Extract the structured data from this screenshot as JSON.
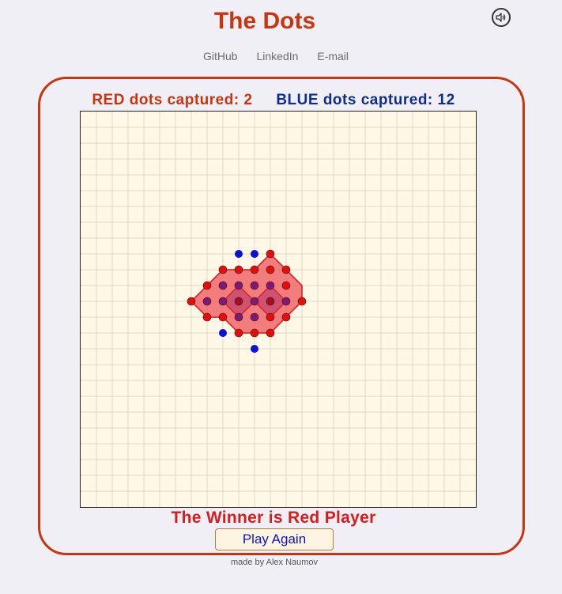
{
  "header": {
    "title": "The Dots",
    "sound_icon": "speaker-icon"
  },
  "links": [
    {
      "label": "GitHub"
    },
    {
      "label": "LinkedIn"
    },
    {
      "label": "E-mail"
    }
  ],
  "scores": {
    "red_label": "RED dots captured:",
    "red_count": "2",
    "blue_label": "BLUE dots captured:",
    "blue_count": "12"
  },
  "board": {
    "cols": 25,
    "rows": 25,
    "background": "#fff8e6",
    "grid_color": "#e3d6c1",
    "red_color": "#e01010",
    "blue_color": "#0a12d8",
    "captured_color": "#7c1a78",
    "territory_color": "#f07070",
    "red_dots": [
      [
        12,
        9
      ],
      [
        11,
        10
      ],
      [
        12,
        10
      ],
      [
        13,
        10
      ],
      [
        9,
        10
      ],
      [
        10,
        10
      ],
      [
        8,
        11
      ],
      [
        9,
        11
      ],
      [
        10,
        11
      ],
      [
        11,
        11
      ],
      [
        12,
        11
      ],
      [
        13,
        11
      ],
      [
        7,
        12
      ],
      [
        14,
        12
      ],
      [
        8,
        13
      ],
      [
        13,
        13
      ],
      [
        10,
        14
      ],
      [
        11,
        14
      ],
      [
        12,
        14
      ],
      [
        9,
        13
      ],
      [
        10,
        13
      ],
      [
        11,
        13
      ],
      [
        12,
        13
      ]
    ],
    "captured_blue": [
      [
        9,
        11
      ],
      [
        10,
        11
      ],
      [
        11,
        11
      ],
      [
        12,
        11
      ],
      [
        8,
        12
      ],
      [
        9,
        12
      ],
      [
        10,
        12
      ],
      [
        11,
        12
      ],
      [
        12,
        12
      ],
      [
        13,
        12
      ],
      [
        10,
        13
      ],
      [
        11,
        13
      ],
      [
        12,
        13
      ],
      [
        9,
        13
      ]
    ],
    "blue_dots": [
      [
        10,
        9
      ],
      [
        11,
        9
      ],
      [
        9,
        14
      ],
      [
        11,
        15
      ]
    ],
    "captured_red": [
      [
        10,
        12
      ],
      [
        12,
        12
      ]
    ]
  },
  "result": {
    "winner_text": "The Winner is Red Player",
    "play_again_label": "Play Again"
  },
  "footer": {
    "credit": "made by Alex Naumov"
  }
}
